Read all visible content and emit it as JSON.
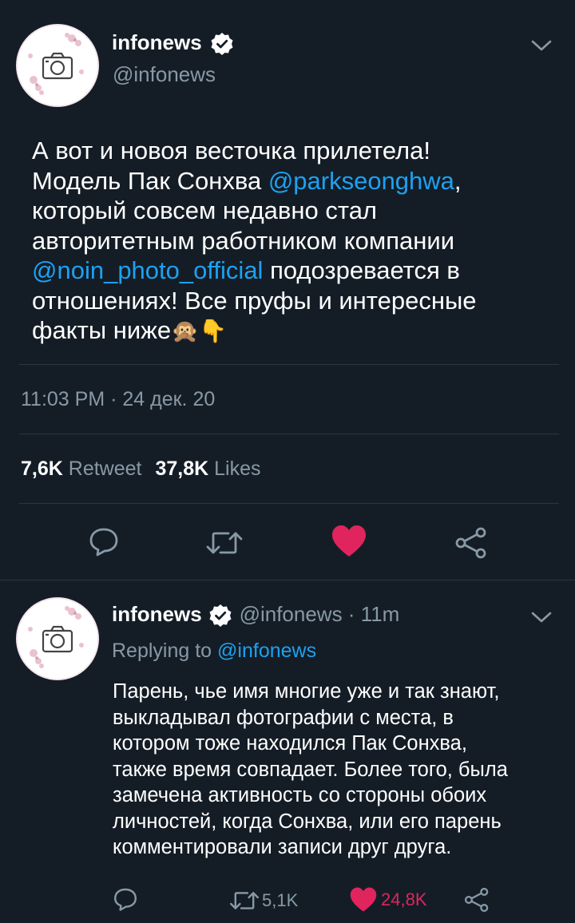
{
  "main_tweet": {
    "name": "infonews",
    "handle": "@infonews",
    "text_parts": {
      "l1": "А вот и новоя весточка прилетела!",
      "l2a": "Модель Пак Сонхва ",
      "l2b": "@parkseonghwa",
      "l2c": ",",
      "l3": "который совсем недавно стал",
      "l4": "авторитетным работником компании",
      "l5a": "@noin_photo_official",
      "l5b": " подозревается в",
      "l6": "отношениях! Все пруфы и интересные",
      "l7": "факты ниже",
      "emoji1": "🙊",
      "emoji2": "👇"
    },
    "timestamp": "11:03 PM · 24 дек. 20",
    "retweets": "7,6K",
    "retweets_label": "Retweet",
    "likes": "37,8K",
    "likes_label": "Likes"
  },
  "reply_tweet": {
    "name": "infonews",
    "handle_time": "@infonews · 11m",
    "replying_prefix": "Replying to ",
    "replying_handle": "@infonews",
    "lines": [
      "Парень, чье имя многие уже и так знают,",
      "выкладывал фотографии с места, в",
      "котором тоже находился Пак Сонхва,",
      "также время совпадает. Более того, была",
      "замечена активность со стороны обоих",
      "личностей, когда Сонхва, или его парень",
      "комментировали записи друг друга."
    ],
    "retweet_count": "5,1K",
    "like_count": "24,8K"
  },
  "colors": {
    "background": "#141d26",
    "link": "#1da1f2",
    "muted": "#8899a6",
    "like": "#e0245e"
  },
  "icons": [
    "verified-badge-icon",
    "chevron-down-icon",
    "reply-icon",
    "retweet-icon",
    "heart-icon",
    "share-icon",
    "camera-icon"
  ]
}
